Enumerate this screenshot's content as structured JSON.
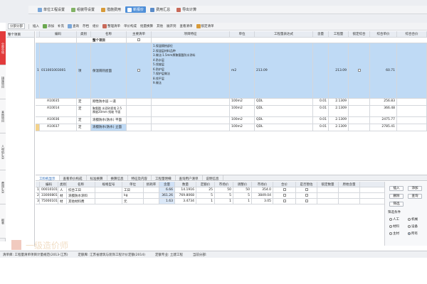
{
  "toolbar1": {
    "items": [
      "单位工程设置",
      "组装导设置",
      "措施费用",
      "新报价",
      "费用汇总",
      "导出计算"
    ],
    "active_index": 3
  },
  "toolbar2": {
    "items": [
      "分部分部",
      "插入",
      "添加",
      "补充",
      "查询",
      "存档",
      "组价",
      "整理清单",
      "单价构成",
      "批量换算",
      "其他",
      "展开到",
      "查看清单",
      "锁定清单"
    ]
  },
  "colors": {
    "accent": "#4f8fd8",
    "selected_row": "#bfdaf5",
    "red_tab": "#e23b3b"
  },
  "sidebar": {
    "tabs": [
      "分部分项",
      "措施项目",
      "其他项目",
      "人材机汇总",
      "费用汇总",
      "报表"
    ],
    "active_index": 0
  },
  "tree": {
    "header": "整个项目",
    "selected": ""
  },
  "main_table": {
    "headers": [
      "编码",
      "类别",
      "名称",
      "主要清单",
      "项目特征",
      "单位",
      "工程量表达式",
      "含量",
      "工程量",
      "锁定综合",
      "综合单价",
      "综合合价"
    ],
    "group_row": {
      "name": "整个项目"
    },
    "rows": [
      {
        "num": "1",
        "code": "011001003001",
        "type": "项",
        "name": "保温隔热屋面",
        "feature": "1.保温隔热部位\n2.保温层材料品种\n3.做法:1.5mm厚聚氨酯防水涂料\n4.防水层\n5.找坡层\n6.防护层\n7.保护层做法\n8.找平层\n9.做法",
        "unit": "m2",
        "expr": "213.09",
        "qty": "",
        "amount": "213.09",
        "price": "60.71",
        "selected": true
      },
      {
        "num": "",
        "code": "A10035",
        "type": "定",
        "name": "刚性防水层 一道",
        "feature": "",
        "unit": "100m2",
        "expr": "QDL",
        "qty": "0.01",
        "amount": "2.1309",
        "price": "256.83",
        "selected": false
      },
      {
        "num": "",
        "code": "A10014",
        "type": "定",
        "name": "聚氨酯 水泥砂浆找 2.5 厚度20mm 找坡 平面",
        "feature": "",
        "unit": "100m2",
        "expr": "QDL",
        "qty": "0.01",
        "amount": "2.1309",
        "price": "366.48",
        "selected": false
      },
      {
        "num": "",
        "code": "A10036",
        "type": "定",
        "name": "涂膜防水(防水) 平面",
        "feature": "",
        "unit": "100m2",
        "expr": "QDL",
        "qty": "0.01",
        "amount": "2.1309",
        "price": "2475.77",
        "selected": false
      },
      {
        "num": "",
        "code": "A10037",
        "type": "定",
        "name": "涂膜防水(防水) 立面",
        "feature": "",
        "unit": "100m2",
        "expr": "QDL",
        "qty": "0.01",
        "amount": "2.1309",
        "price": "2785.41",
        "selected": false
      }
    ]
  },
  "bottom_tabs": [
    "工料机显示",
    "查看单价构成",
    "标准换算",
    "换算信息",
    "特征及内容",
    "工程量明细",
    "查询用户清单",
    "说明信息"
  ],
  "bottom_table": {
    "headers": [
      "编码",
      "类别",
      "名称",
      "规格型号",
      "单位",
      "损耗率",
      "含量",
      "数量",
      "定额价",
      "市场价",
      "调整价",
      "市场价",
      "合价",
      "是否暂估",
      "锁定数量",
      "原始含量"
    ],
    "rows": [
      {
        "num": "1",
        "code": "00010101",
        "type": "人",
        "name": "综合工日",
        "unit": "工日",
        "loss": "",
        "content": "6.66",
        "qty": "14.1916",
        "p1": "25",
        "p2": "50",
        "p3": "50",
        "total": "354.0"
      },
      {
        "num": "2",
        "code": "33000801",
        "type": "材",
        "name": "涂膜防水涂料",
        "unit": "kg",
        "loss": "",
        "content": "361.26",
        "qty": "769.8068",
        "p1": "5",
        "p2": "5",
        "p3": "5",
        "total": "3849.04"
      },
      {
        "num": "3",
        "code": "75000101",
        "type": "材",
        "name": "其他材料费",
        "unit": "元",
        "loss": "",
        "content": "1.63",
        "qty": "3.4734",
        "p1": "1",
        "p2": "1",
        "p3": "1",
        "total": "3.05"
      }
    ]
  },
  "right_panel": {
    "buttons": [
      "插入",
      "添加",
      "删除",
      "查询",
      "筛选"
    ],
    "filter_title": "筛选条件",
    "options": [
      "人工",
      "机械",
      "材料",
      "设备",
      "主材",
      "所有"
    ]
  },
  "status": {
    "items": [
      "清单库: 工程量清单项目计量规范(2013-江苏)",
      "定额库: 江苏省建筑与装饰工程计价定额(2014)",
      "定额专业: 土建工程",
      "当前分部:"
    ]
  },
  "watermark": "一级造价师"
}
